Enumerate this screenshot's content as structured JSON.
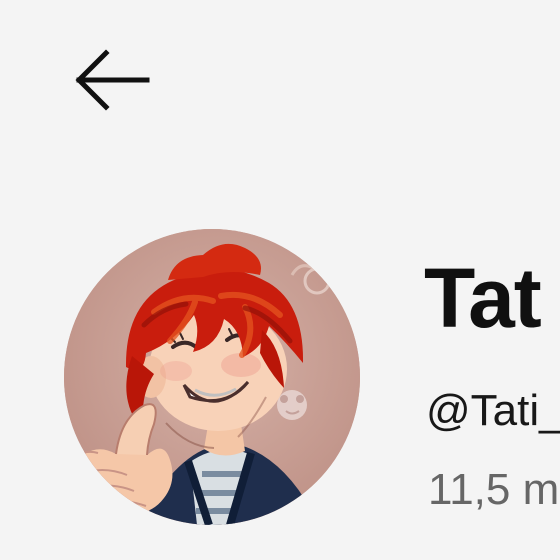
{
  "header": {
    "back_icon": "arrow-left-icon"
  },
  "channel": {
    "avatar_icon": "profile-avatar-illustration",
    "title": "Tat",
    "handle": "@Tati_",
    "subscribers": "11,5 m"
  },
  "colors": {
    "background": "#f4f4f4",
    "title": "#101010",
    "handle": "#181818",
    "secondary_text": "#666666",
    "avatar_background": "#c9a095",
    "hair": "#c91d0d"
  }
}
